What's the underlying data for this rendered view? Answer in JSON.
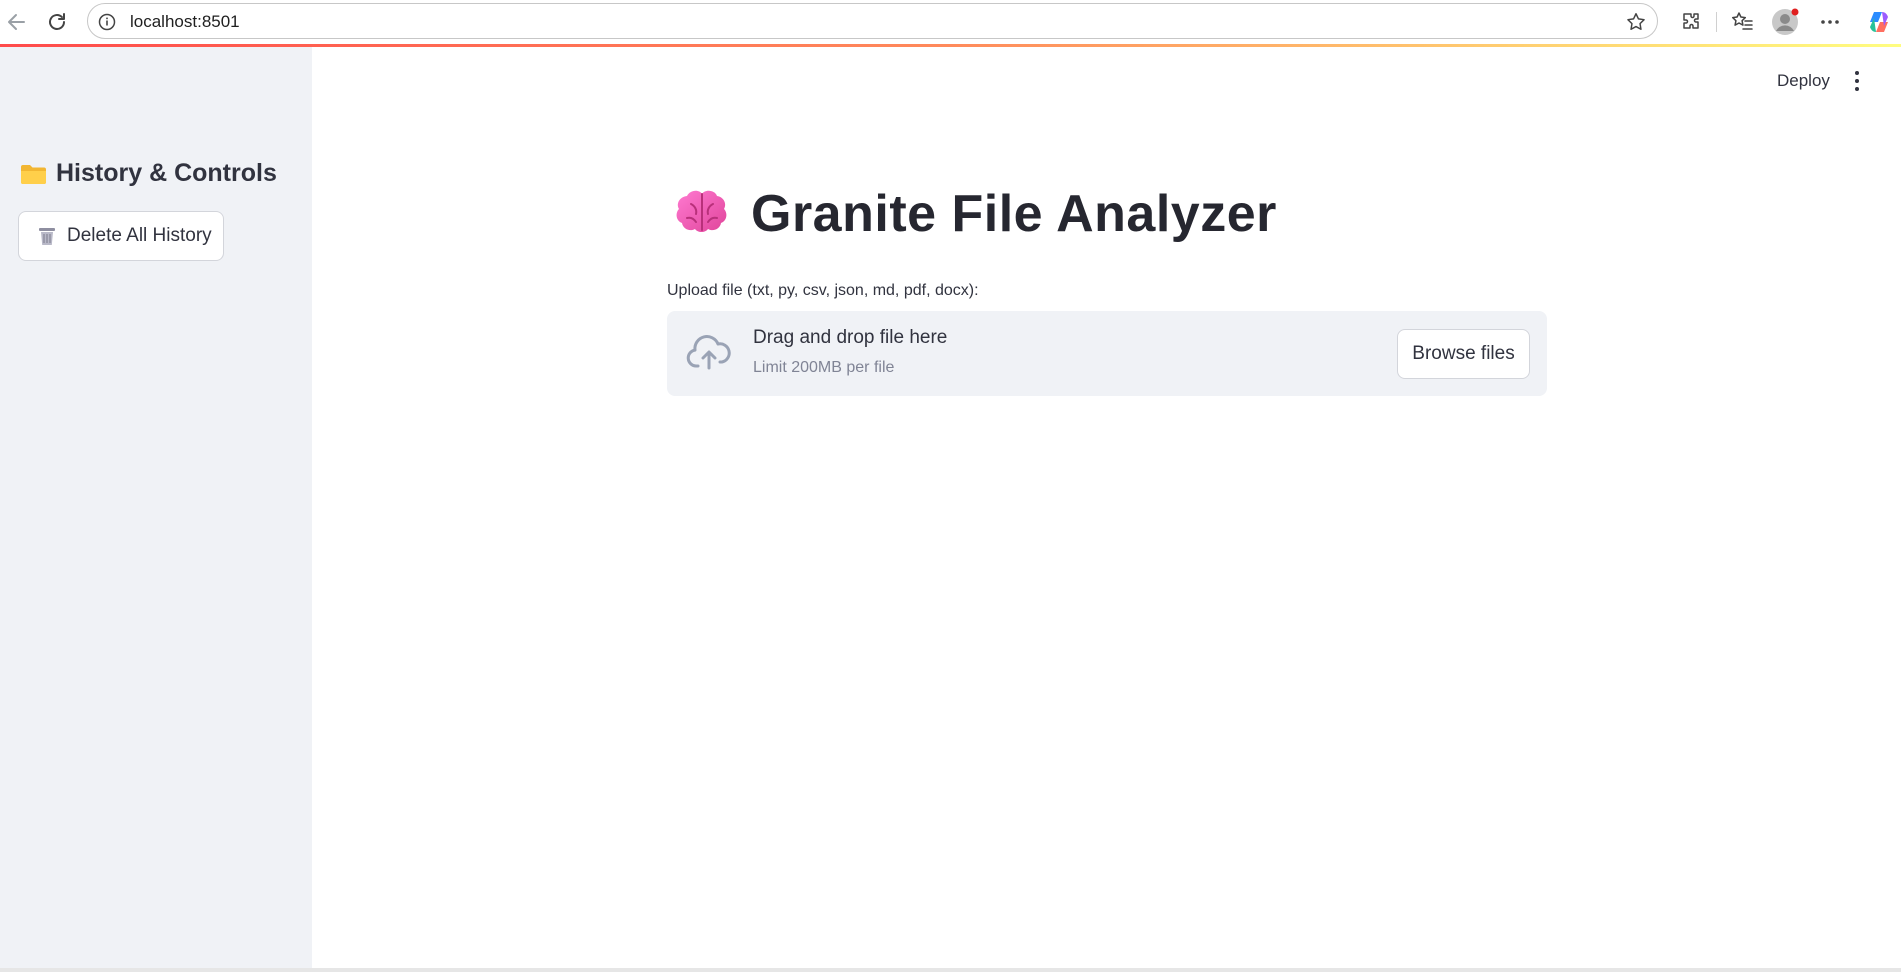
{
  "browser": {
    "url": "localhost:8501"
  },
  "sidebar": {
    "title": "History & Controls",
    "delete_button_label": "Delete All History"
  },
  "toolbar": {
    "deploy_label": "Deploy"
  },
  "main": {
    "title": "Granite File Analyzer",
    "upload_label": "Upload file (txt, py, csv, json, md, pdf, docx):",
    "dropzone_text": "Drag and drop file here",
    "dropzone_limit": "Limit 200MB per file",
    "browse_button_label": "Browse files"
  },
  "icons": {
    "back": "back-arrow-icon",
    "reload": "reload-icon",
    "info": "info-icon",
    "favorite": "star-icon",
    "extensions": "extensions-icon",
    "favorites": "favorites-icon",
    "profile": "profile-icon",
    "more": "more-icon",
    "copilot": "copilot-icon",
    "folder": "folder-icon",
    "trash": "trash-icon",
    "brain": "brain-icon",
    "upload": "cloud-upload-icon",
    "menu": "kebab-menu-icon"
  },
  "colors": {
    "accent": "#ff4b4b",
    "sidebar_bg": "#f0f2f6",
    "text": "#31333f",
    "muted": "#808495"
  }
}
